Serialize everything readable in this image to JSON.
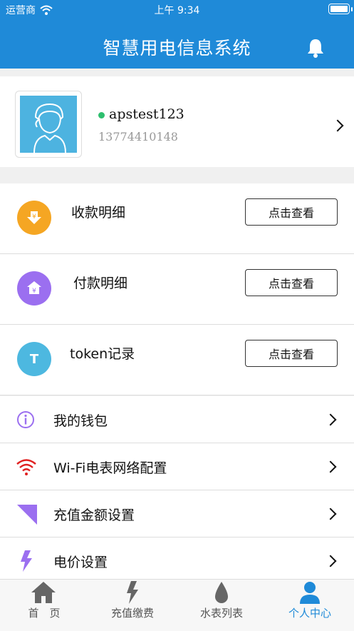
{
  "status_bar": {
    "carrier": "运营商",
    "time": "上午 9:34"
  },
  "header": {
    "title": "智慧用电信息系统",
    "bell_icon": "bell-icon"
  },
  "profile": {
    "online_status": "online",
    "username": "apstest123",
    "phone": "13774410148"
  },
  "records": [
    {
      "label": "收款明细",
      "button": "点击查看",
      "icon": "download-yen-icon",
      "color": "#f5a623"
    },
    {
      "label": "付款明细",
      "button": "点击查看",
      "icon": "house-yen-icon",
      "color": "#9b6ff0"
    },
    {
      "label": "token记录",
      "button": "点击查看",
      "icon": "letter-t-icon",
      "color": "#4db8e0",
      "icon_text": "T"
    }
  ],
  "menu": [
    {
      "label": "我的钱包",
      "icon": "info-circle-icon"
    },
    {
      "label": "Wi-Fi电表网络配置",
      "icon": "wifi-icon"
    },
    {
      "label": "充值金额设置",
      "icon": "triangle-icon"
    },
    {
      "label": "电价设置",
      "icon": "lightning-icon"
    }
  ],
  "tabbar": [
    {
      "label": "首　页",
      "icon": "home-icon",
      "active": false
    },
    {
      "label": "充值缴费",
      "icon": "lightning-icon",
      "active": false
    },
    {
      "label": "水表列表",
      "icon": "water-drop-icon",
      "active": false
    },
    {
      "label": "个人中心",
      "icon": "person-icon",
      "active": true
    }
  ],
  "colors": {
    "primary": "#1f8ad8",
    "online": "#2ebf6e"
  }
}
